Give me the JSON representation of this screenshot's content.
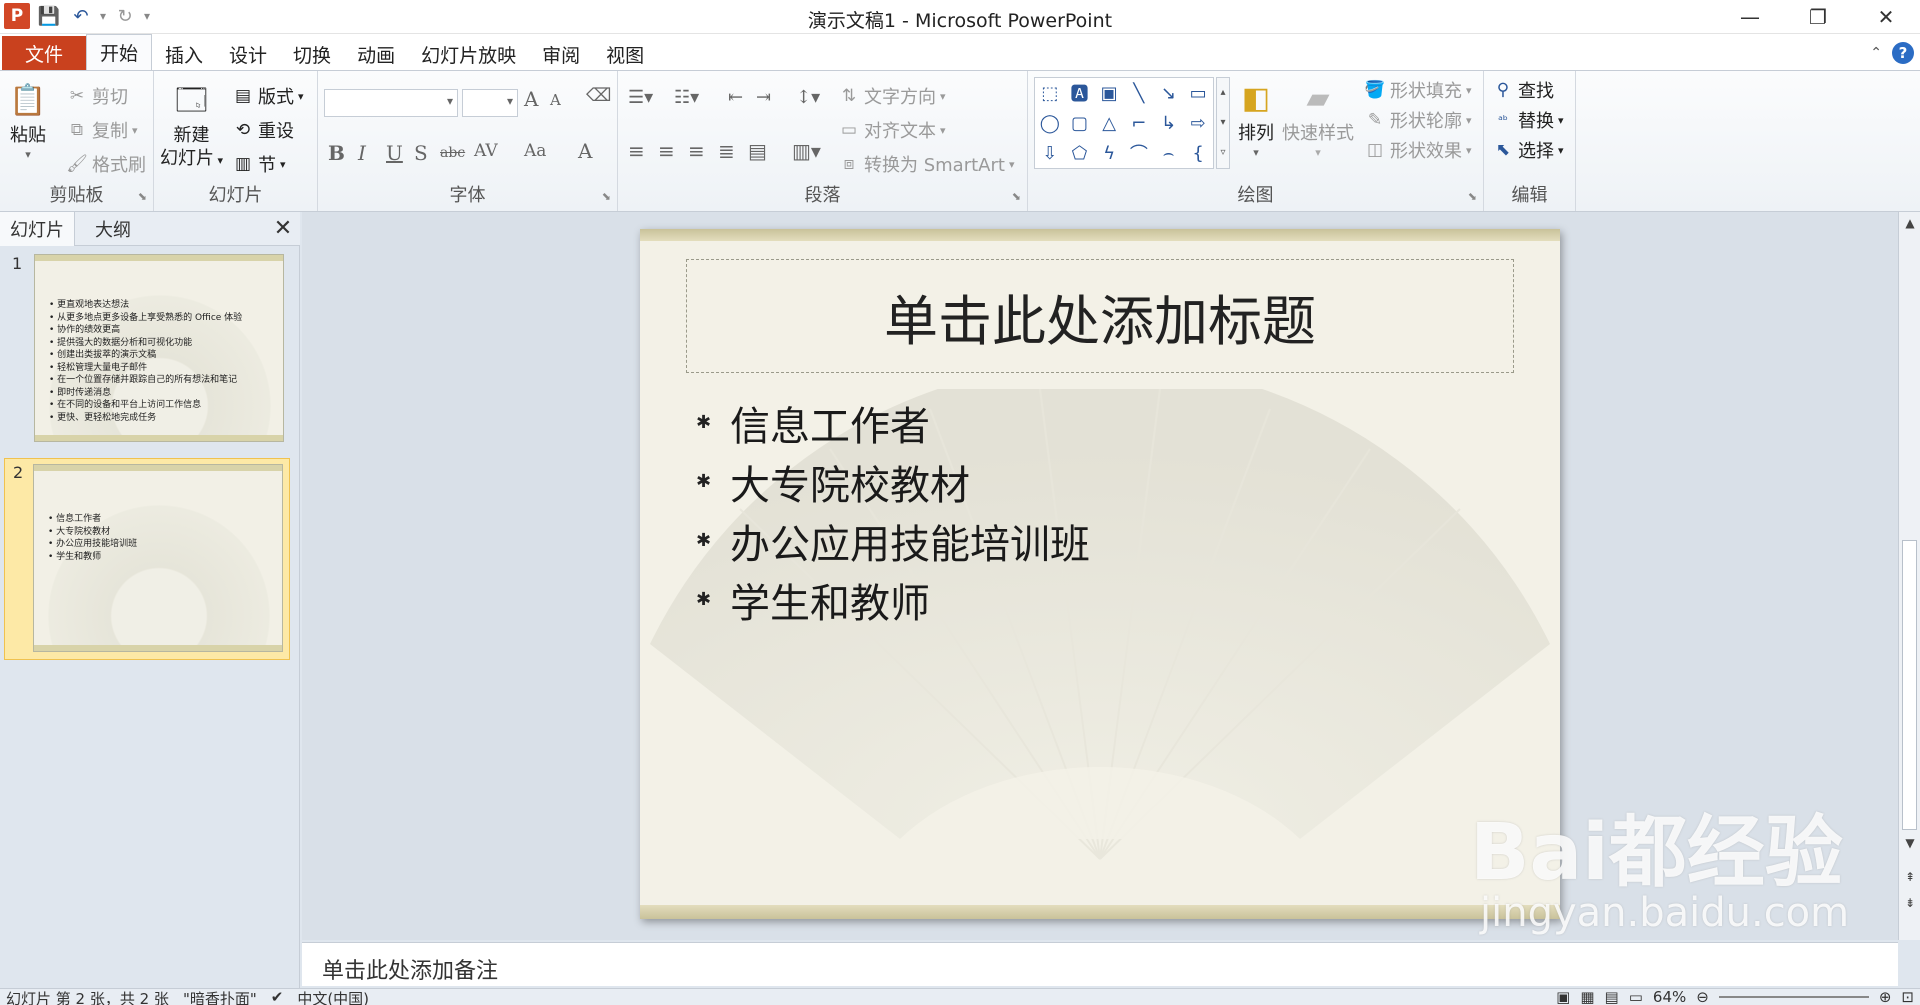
{
  "window": {
    "title": "演示文稿1 - Microsoft PowerPoint",
    "logo_letter": "P"
  },
  "tabs": {
    "file": "文件",
    "items": [
      "开始",
      "插入",
      "设计",
      "切换",
      "动画",
      "幻灯片放映",
      "审阅",
      "视图"
    ],
    "active": "开始"
  },
  "ribbon": {
    "clipboard": {
      "paste": "粘贴",
      "cut": "剪切",
      "copy": "复制",
      "format_painter": "格式刷",
      "label": "剪贴板"
    },
    "slides": {
      "new_slide_line1": "新建",
      "new_slide_line2": "幻灯片",
      "layout": "版式",
      "reset": "重设",
      "section": "节",
      "label": "幻灯片"
    },
    "font": {
      "label": "字体",
      "bold": "B",
      "italic": "I",
      "underline": "U",
      "shadow": "S",
      "strike": "abc",
      "spacing": "AV",
      "case": "Aa",
      "grow": "A",
      "shrink": "A",
      "color": "A"
    },
    "paragraph": {
      "text_direction": "文字方向",
      "align_text": "对齐文本",
      "smartart": "转换为 SmartArt",
      "label": "段落"
    },
    "drawing": {
      "arrange": "排列",
      "quick_styles": "快速样式",
      "shape_fill": "形状填充",
      "shape_outline": "形状轮廓",
      "shape_effects": "形状效果",
      "label": "绘图"
    },
    "editing": {
      "find": "查找",
      "replace": "替换",
      "select": "选择",
      "label": "编辑"
    }
  },
  "left_pane": {
    "tabs": [
      "幻灯片",
      "大纲"
    ],
    "active_tab": "幻灯片",
    "slides": [
      {
        "number": "1",
        "bullets": [
          "更直观地表达想法",
          "从更多地点更多设备上享受熟悉的  Office 体验",
          "协作的绩效更高",
          "提供强大的数据分析和可视化功能",
          "创建出类拔萃的演示文稿",
          "轻松管理大量电子邮件",
          "在一个位置存储并跟踪自己的所有想法和笔记",
          "即时传递消息",
          "在不同的设备和平台上访问工作信息",
          "更快、更轻松地完成任务"
        ]
      },
      {
        "number": "2",
        "bullets": [
          "信息工作者",
          "大专院校教材",
          "办公应用技能培训班",
          "学生和教师"
        ]
      }
    ]
  },
  "slide": {
    "title_placeholder": "单击此处添加标题",
    "bullets": [
      "信息工作者",
      "大专院校教材",
      "办公应用技能培训班",
      "学生和教师"
    ]
  },
  "notes": {
    "placeholder": "单击此处添加备注"
  },
  "status": {
    "slide_info": "幻灯片 第 2 张，共 2 张",
    "theme": "\"暗香扑面\"",
    "language": "中文(中国)",
    "zoom": "64%"
  },
  "watermark": {
    "logo": "Bai都经验",
    "url": "jingyan.baidu.com"
  },
  "colors": {
    "file_tab": "#c9411e",
    "accent": "#2b579a",
    "slide_bg": "#f3f1e7",
    "selected_thumb": "#fde9a6"
  }
}
